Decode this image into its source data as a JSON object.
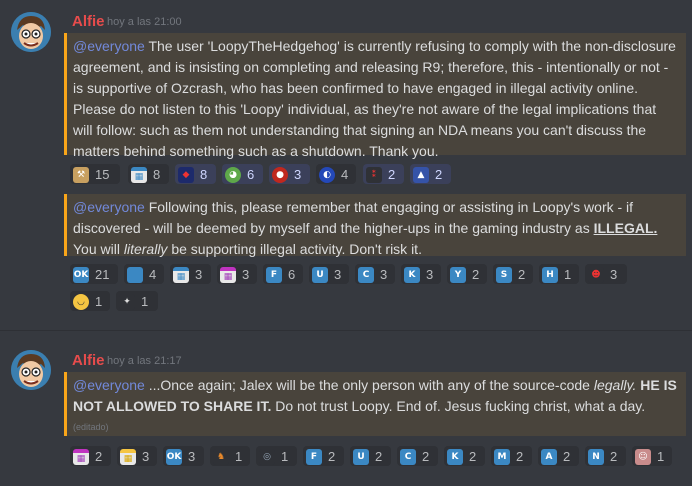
{
  "messages": [
    {
      "author": "Alfie",
      "timestamp": "hoy a las 21:00",
      "blocks": [
        {
          "mention": "@everyone",
          "text": " The user 'LoopyTheHedgehog' is currently refusing to comply with the non-disclosure agreement, and is insisting on completing and releasing R9; therefore, this - intentionally or not - is supportive of Ozcrash, who has been confirmed to have engaged in illegal activity online. Please do not listen to this 'Loopy' individual, as they're not aware of the legal implications that will follow: such as them not understanding that signing an NDA means you can't discuss the matters behind something such as a shutdown. Thank you."
        },
        {
          "mention": "@everyone",
          "text_1": " Following this, please remember that engaging or assisting in Loopy's work - if discovered - will be deemed by myself and the higher-ups in the gaming industry as ",
          "bold": "ILLEGAL.",
          "text_2": " You will ",
          "italic": "literally",
          "text_3": " be supporting illegal activity. Don't risk it."
        }
      ],
      "reactions_1": [
        {
          "icon": "hammer-emoji",
          "label": "",
          "count": "15"
        },
        {
          "icon": "calendar-emoji",
          "label": "",
          "count": "8"
        },
        {
          "icon": "sonic-exe-emoji",
          "label": "",
          "count": "8"
        },
        {
          "icon": "pepe-emoji",
          "label": "",
          "count": "6"
        },
        {
          "icon": "knuckles-emoji",
          "label": "",
          "count": "3"
        },
        {
          "icon": "sonic-emoji",
          "label": "",
          "count": "4"
        },
        {
          "icon": "pixel-emoji",
          "label": "",
          "count": "2"
        },
        {
          "icon": "mecha-emoji",
          "label": "",
          "count": "2"
        }
      ],
      "reactions_2": [
        {
          "icon": "ok-emoji",
          "label": "OK",
          "count": "21"
        },
        {
          "icon": "blue-square-emoji",
          "label": "",
          "count": "4"
        },
        {
          "icon": "calendar-emoji",
          "label": "",
          "count": "3"
        },
        {
          "icon": "pink-calendar-emoji",
          "label": "",
          "count": "3"
        },
        {
          "icon": "regional-f-emoji",
          "label": "F",
          "count": "6"
        },
        {
          "icon": "regional-u-emoji",
          "label": "U",
          "count": "3"
        },
        {
          "icon": "regional-c-emoji",
          "label": "C",
          "count": "3"
        },
        {
          "icon": "regional-k-emoji",
          "label": "K",
          "count": "3"
        },
        {
          "icon": "regional-y-emoji",
          "label": "Y",
          "count": "2"
        },
        {
          "icon": "regional-s-emoji",
          "label": "S",
          "count": "2"
        },
        {
          "icon": "regional-h-emoji",
          "label": "H",
          "count": "1"
        },
        {
          "icon": "gaster-emoji",
          "label": "",
          "count": "3"
        }
      ],
      "reactions_3": [
        {
          "icon": "sweat-smile-emoji",
          "label": "",
          "count": "1"
        },
        {
          "icon": "sonic-sticker-emoji",
          "label": "",
          "count": "1"
        }
      ]
    },
    {
      "author": "Alfie",
      "timestamp": "hoy a las 21:17",
      "mention": "@everyone",
      "text_1": " ...Once again; Jalex will be the only person with any of the source-code ",
      "italic": "legally.",
      "bold_1": " HE IS NOT ALLOWED TO SHARE IT.",
      "text_2": " Do not trust Loopy. End of. Jesus fucking christ, what a day.",
      "edited": "(editado)",
      "reactions": [
        {
          "icon": "pink-calendar-emoji",
          "label": "",
          "count": "2"
        },
        {
          "icon": "yellow-calendar-emoji",
          "label": "",
          "count": "3"
        },
        {
          "icon": "ok-emoji",
          "label": "OK",
          "count": "3"
        },
        {
          "icon": "fox-emoji",
          "label": "",
          "count": "1"
        },
        {
          "icon": "owl-emoji",
          "label": "",
          "count": "1"
        },
        {
          "icon": "regional-f-emoji",
          "label": "F",
          "count": "2"
        },
        {
          "icon": "regional-u-emoji",
          "label": "U",
          "count": "2"
        },
        {
          "icon": "regional-c-emoji",
          "label": "C",
          "count": "2"
        },
        {
          "icon": "regional-k-emoji",
          "label": "K",
          "count": "2"
        },
        {
          "icon": "regional-m-emoji",
          "label": "M",
          "count": "2"
        },
        {
          "icon": "regional-a-emoji",
          "label": "A",
          "count": "2"
        },
        {
          "icon": "regional-n-emoji",
          "label": "N",
          "count": "2"
        },
        {
          "icon": "face-emoji",
          "label": "",
          "count": "1"
        }
      ]
    }
  ],
  "colors": {
    "background": "#36393f",
    "author": "#e74c4c",
    "mention": "#7289da",
    "mention_bg": "#49443c",
    "mention_bar": "#faa61a",
    "reaction": "#2f3136",
    "regional": "#3b88c3"
  }
}
